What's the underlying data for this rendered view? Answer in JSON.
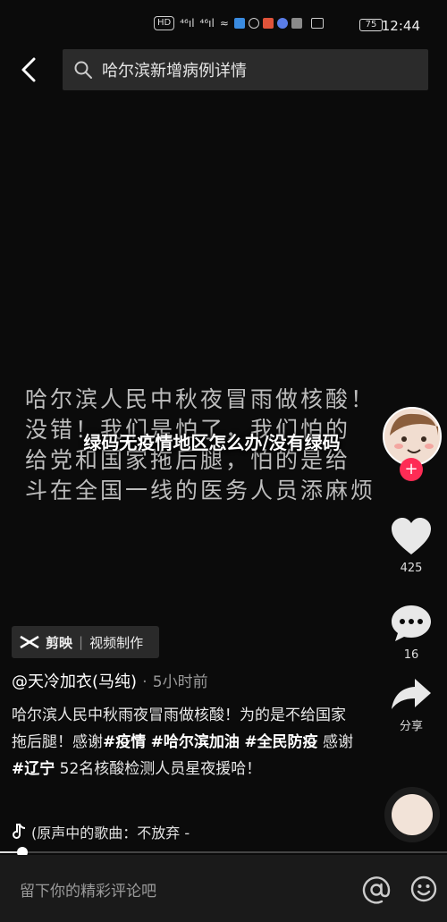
{
  "status_bar": {
    "left_badges": [
      "HD",
      "⁴⁶ıl",
      "⁴⁶ıl",
      "≈"
    ],
    "battery": "75",
    "time": "12:44"
  },
  "search": {
    "query": "哈尔滨新增病例详情"
  },
  "video": {
    "caption_lines": [
      "哈尔滨人民中秋夜冒雨做核酸！",
      "没错！我们是怕了，我们怕的",
      "给党和国家拖后腿，怕的是给",
      "斗在全国一线的医务人员添麻烦"
    ],
    "overlay_title": "绿码无疫情地区怎么办/没有绿码"
  },
  "actions": {
    "likes": "425",
    "comments": "16",
    "share_label": "分享"
  },
  "capcut": {
    "app": "剪映",
    "template": "视频制作"
  },
  "author": {
    "name": "@天冷加衣(马纯)",
    "time": "5小时前"
  },
  "post": {
    "segments": [
      {
        "text": "哈尔滨人民中秋雨夜冒雨做核酸！为的是不给国家拖后腿！感谢",
        "tag": false
      },
      {
        "text": "#疫情",
        "tag": true
      },
      {
        "text": " ",
        "tag": false
      },
      {
        "text": "#哈尔滨加油",
        "tag": true
      },
      {
        "text": " ",
        "tag": false
      },
      {
        "text": "#全民防疫",
        "tag": true
      },
      {
        "text": " 感谢",
        "tag": false
      },
      {
        "text": "#辽宁",
        "tag": true
      },
      {
        "text": " 52名核酸检测人员星夜援哈！",
        "tag": false
      }
    ]
  },
  "music": {
    "title": "(原声中的歌曲：不放弃 -"
  },
  "playback": {
    "progress": 0.05
  },
  "comment": {
    "placeholder": "留下你的精彩评论吧"
  },
  "colors": {
    "accent": "#fe2c55",
    "background": "#0b0b0b"
  }
}
